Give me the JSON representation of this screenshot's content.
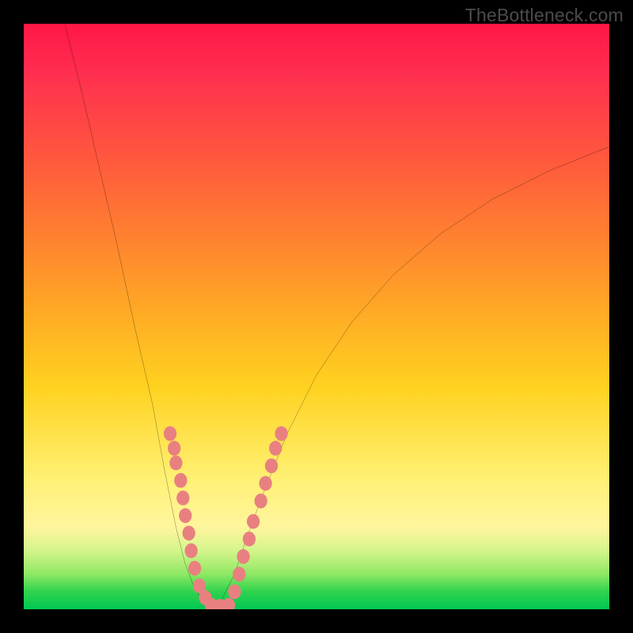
{
  "watermark": "TheBottleneck.com",
  "chart_data": {
    "type": "line",
    "title": "",
    "xlabel": "",
    "ylabel": "",
    "xlim": [
      0,
      100
    ],
    "ylim": [
      0,
      100
    ],
    "grid": false,
    "series": [
      {
        "name": "bottleneck-curve-left",
        "x": [
          7,
          10,
          13,
          16,
          19,
          22,
          24,
          26,
          27.5,
          29,
          30.5,
          32
        ],
        "y": [
          100,
          88,
          75,
          62,
          48,
          35,
          24,
          14,
          8,
          4,
          1.5,
          0
        ]
      },
      {
        "name": "bottleneck-curve-right",
        "x": [
          32,
          34,
          36,
          38,
          41,
          45,
          50,
          56,
          63,
          71,
          80,
          90,
          100
        ],
        "y": [
          0,
          2,
          6,
          12,
          20,
          30,
          40,
          49,
          57,
          64,
          70,
          75,
          79
        ]
      }
    ],
    "markers": {
      "name": "dots",
      "color": "#e98080",
      "radius": 1.1,
      "points": [
        {
          "x": 25.0,
          "y": 30.0
        },
        {
          "x": 25.7,
          "y": 27.5
        },
        {
          "x": 26.0,
          "y": 25.0
        },
        {
          "x": 26.8,
          "y": 22.0
        },
        {
          "x": 27.2,
          "y": 19.0
        },
        {
          "x": 27.6,
          "y": 16.0
        },
        {
          "x": 28.2,
          "y": 13.0
        },
        {
          "x": 28.6,
          "y": 10.0
        },
        {
          "x": 29.2,
          "y": 7.0
        },
        {
          "x": 30.0,
          "y": 4.0
        },
        {
          "x": 31.0,
          "y": 2.0
        },
        {
          "x": 32.0,
          "y": 0.7
        },
        {
          "x": 33.5,
          "y": 0.5
        },
        {
          "x": 35.0,
          "y": 0.7
        },
        {
          "x": 36.0,
          "y": 3.0
        },
        {
          "x": 36.8,
          "y": 6.0
        },
        {
          "x": 37.5,
          "y": 9.0
        },
        {
          "x": 38.5,
          "y": 12.0
        },
        {
          "x": 39.2,
          "y": 15.0
        },
        {
          "x": 40.5,
          "y": 18.5
        },
        {
          "x": 41.3,
          "y": 21.5
        },
        {
          "x": 42.3,
          "y": 24.5
        },
        {
          "x": 43.0,
          "y": 27.5
        },
        {
          "x": 44.0,
          "y": 30.0
        }
      ]
    },
    "gradient_stops": [
      {
        "pos": 0.0,
        "color": "#ff1744"
      },
      {
        "pos": 0.08,
        "color": "#ff2d50"
      },
      {
        "pos": 0.22,
        "color": "#ff553e"
      },
      {
        "pos": 0.35,
        "color": "#ff7d31"
      },
      {
        "pos": 0.48,
        "color": "#ffa626"
      },
      {
        "pos": 0.62,
        "color": "#ffd21f"
      },
      {
        "pos": 0.78,
        "color": "#fff176"
      },
      {
        "pos": 0.86,
        "color": "#fff59d"
      },
      {
        "pos": 0.9,
        "color": "#d4f58b"
      },
      {
        "pos": 0.94,
        "color": "#8ee864"
      },
      {
        "pos": 0.97,
        "color": "#2fd34e"
      },
      {
        "pos": 1.0,
        "color": "#00c853"
      }
    ]
  }
}
